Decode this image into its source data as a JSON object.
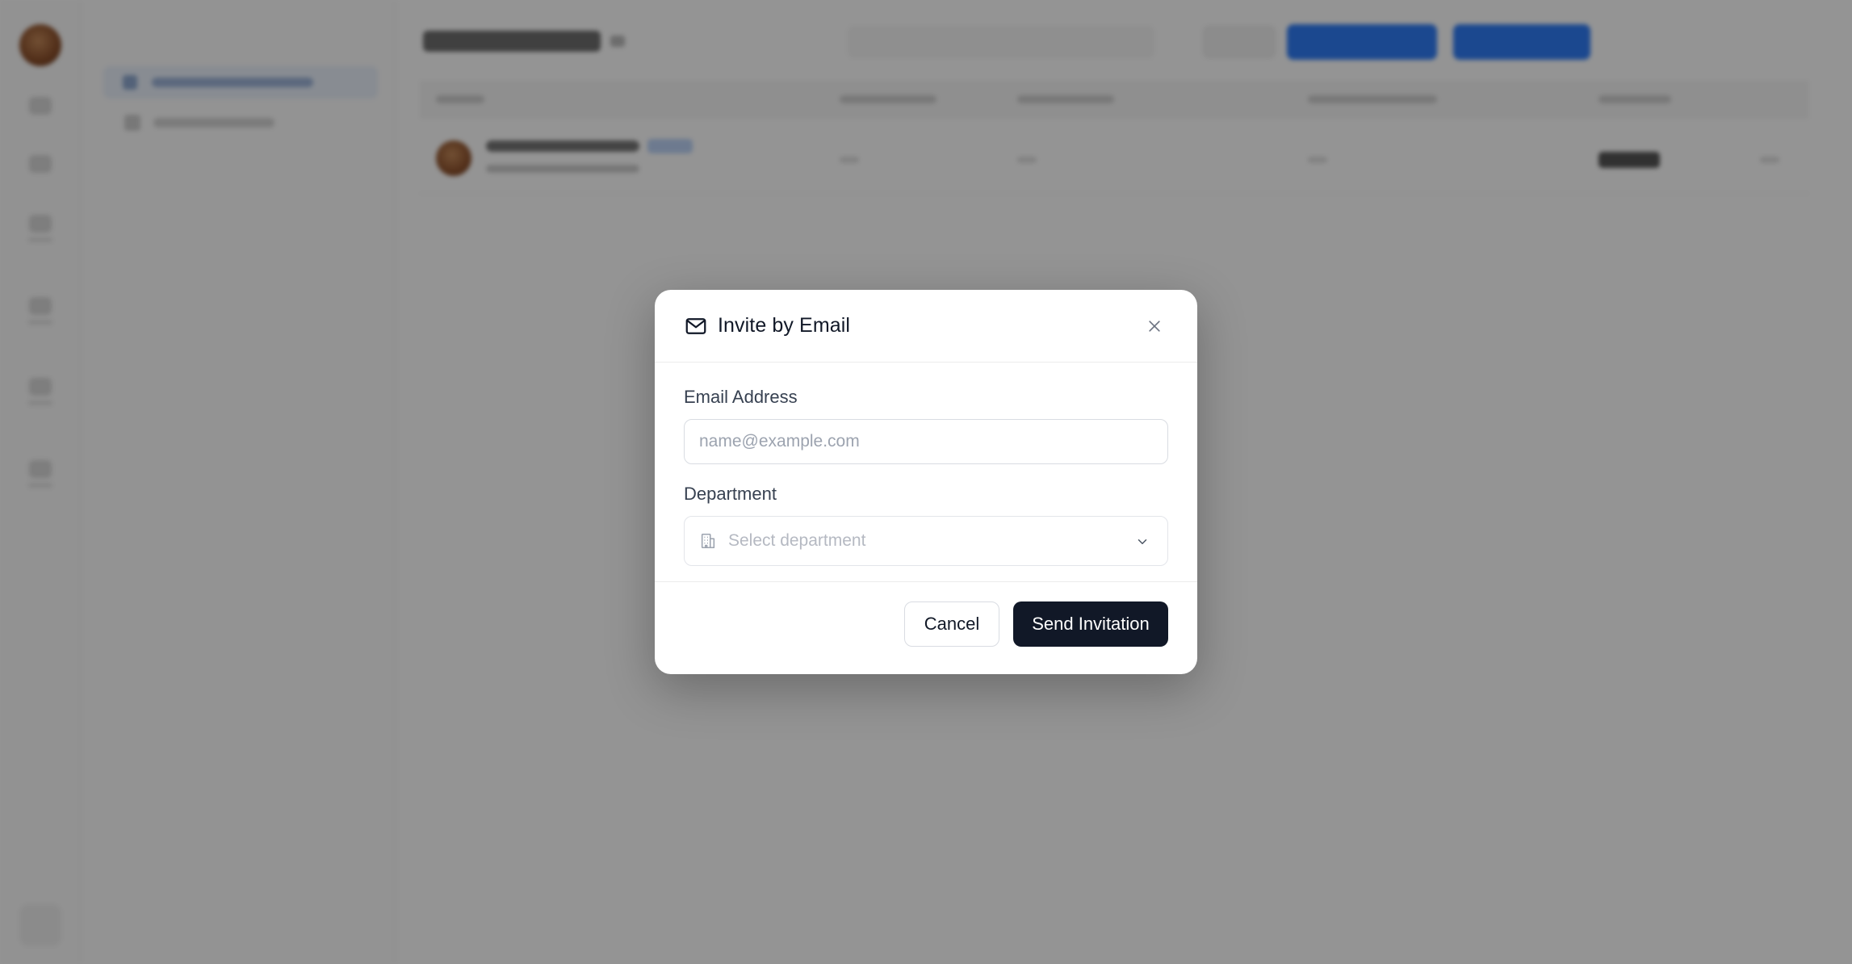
{
  "modal": {
    "title": "Invite by Email",
    "title_icon": "mail-icon",
    "close_icon": "close-icon",
    "email": {
      "label": "Email Address",
      "value": "",
      "placeholder": "name@example.com"
    },
    "department": {
      "label": "Department",
      "placeholder": "Select department",
      "icon": "building-icon",
      "chevron_icon": "chevron-down-icon"
    },
    "actions": {
      "cancel_label": "Cancel",
      "send_label": "Send Invitation"
    }
  },
  "colors": {
    "overlay": "rgba(0,0,0,0.42)",
    "primary_button": "#111827",
    "background_accent": "#2f7cf6"
  }
}
